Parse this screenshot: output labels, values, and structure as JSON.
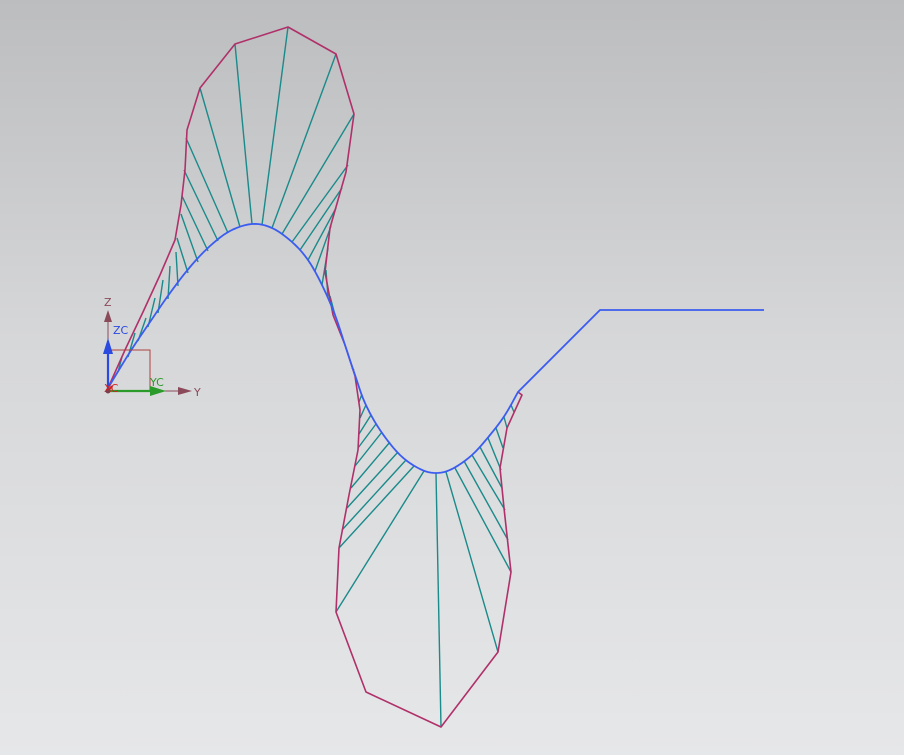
{
  "colors": {
    "spline": "#3b5cf0",
    "comb_teeth": "#1a8a8a",
    "comb_envelope": "#b0306a",
    "axis_z": "#8a4a5a",
    "axis_zc": "#2a4ae0",
    "axis_yc": "#2a9a2a",
    "axis_y": "#8a4a5a",
    "axis_xc": "#d02020"
  },
  "triad": {
    "z_label": "Z",
    "zc_label": "ZC",
    "yc_label": "YC",
    "y_label": "Y",
    "xc_label": "XC"
  },
  "icons": {
    "triad": "csys-triad-icon"
  }
}
